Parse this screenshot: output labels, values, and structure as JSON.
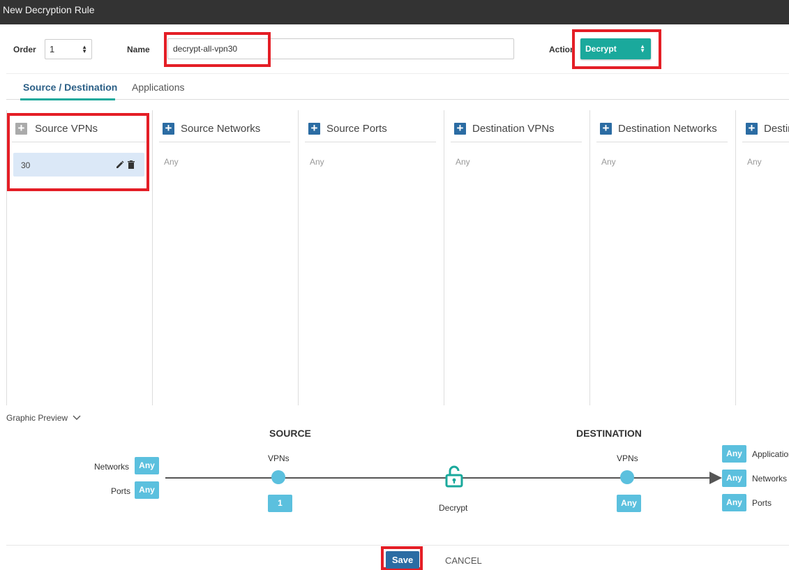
{
  "window": {
    "title": "New Decryption Rule"
  },
  "form": {
    "order_label": "Order",
    "order_value": "1",
    "name_label": "Name",
    "name_value": "decrypt-all-vpn30",
    "action_label": "Action",
    "action_value": "Decrypt"
  },
  "tabs": [
    "Source / Destination",
    "Applications"
  ],
  "columns": [
    {
      "title": "Source VPNs",
      "any": ""
    },
    {
      "title": "Source Networks",
      "any": "Any"
    },
    {
      "title": "Source Ports",
      "any": "Any"
    },
    {
      "title": "Destination VPNs",
      "any": "Any"
    },
    {
      "title": "Destination Networks",
      "any": "Any"
    },
    {
      "title": "Destination Ports",
      "any": "Any"
    }
  ],
  "source_vpn_item": "30",
  "preview": {
    "toggle_label": "Graphic Preview",
    "source_heading": "SOURCE",
    "destination_heading": "DESTINATION",
    "src_networks_label": "Networks",
    "src_networks_value": "Any",
    "src_ports_label": "Ports",
    "src_ports_value": "Any",
    "src_vpns_label": "VPNs",
    "src_vpns_value": "1",
    "action_label": "Decrypt",
    "dst_vpns_label": "VPNs",
    "dst_vpns_value": "Any",
    "dst_applications_label": "Applications",
    "dst_applications_value": "Any",
    "dst_networks_label": "Networks",
    "dst_networks_value": "Any",
    "dst_ports_label": "Ports",
    "dst_ports_value": "Any"
  },
  "footer": {
    "save_label": "Save",
    "cancel_label": "CANCEL"
  },
  "colors": {
    "accent": "#1aa99c",
    "primary": "#2b6ca3",
    "badge": "#5bc0de",
    "highlight": "#e41e26"
  }
}
